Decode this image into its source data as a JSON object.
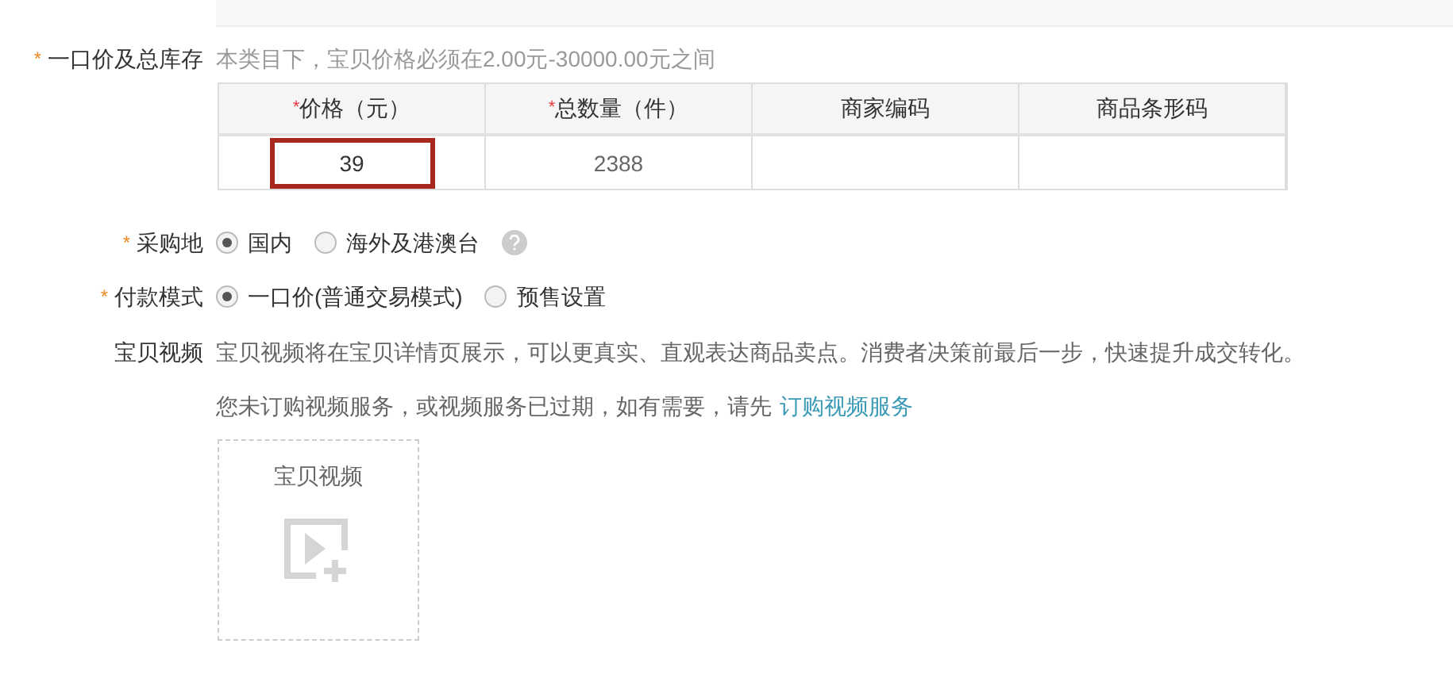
{
  "price_stock": {
    "label": "一口价及总库存",
    "mark": "*",
    "hint": "本类目下，宝贝价格必须在2.00元-30000.00元之间",
    "columns": [
      {
        "label": "价格（元）",
        "mark": "*"
      },
      {
        "label": "总数量（件）",
        "mark": "*"
      },
      {
        "label": "商家编码"
      },
      {
        "label": "商品条形码"
      }
    ],
    "values": [
      {
        "value": "39",
        "highlighted": true
      },
      {
        "value": "2388",
        "highlighted": false
      },
      {
        "highlighted": false
      },
      {
        "highlighted": false
      }
    ]
  },
  "purchase_location": {
    "label": "采购地",
    "mark": "*",
    "help": true,
    "options": [
      {
        "label": "国内",
        "selected": true
      },
      {
        "label": "海外及港澳台",
        "selected": false
      }
    ]
  },
  "payment_mode": {
    "label": "付款模式",
    "mark": "*",
    "options": [
      {
        "label": "一口价(普通交易模式)",
        "selected": true
      },
      {
        "label": "预售设置",
        "selected": false
      }
    ]
  },
  "video": {
    "label": "宝贝视频",
    "description": "宝贝视频将在宝贝详情页展示，可以更真实、直观表达商品卖点。消费者决策前最后一步，快速提升成交转化。",
    "notice": "您未订购视频服务，或视频服务已过期，如有需要，请先",
    "link": "订购视频服务",
    "upload_label": "宝贝视频"
  }
}
